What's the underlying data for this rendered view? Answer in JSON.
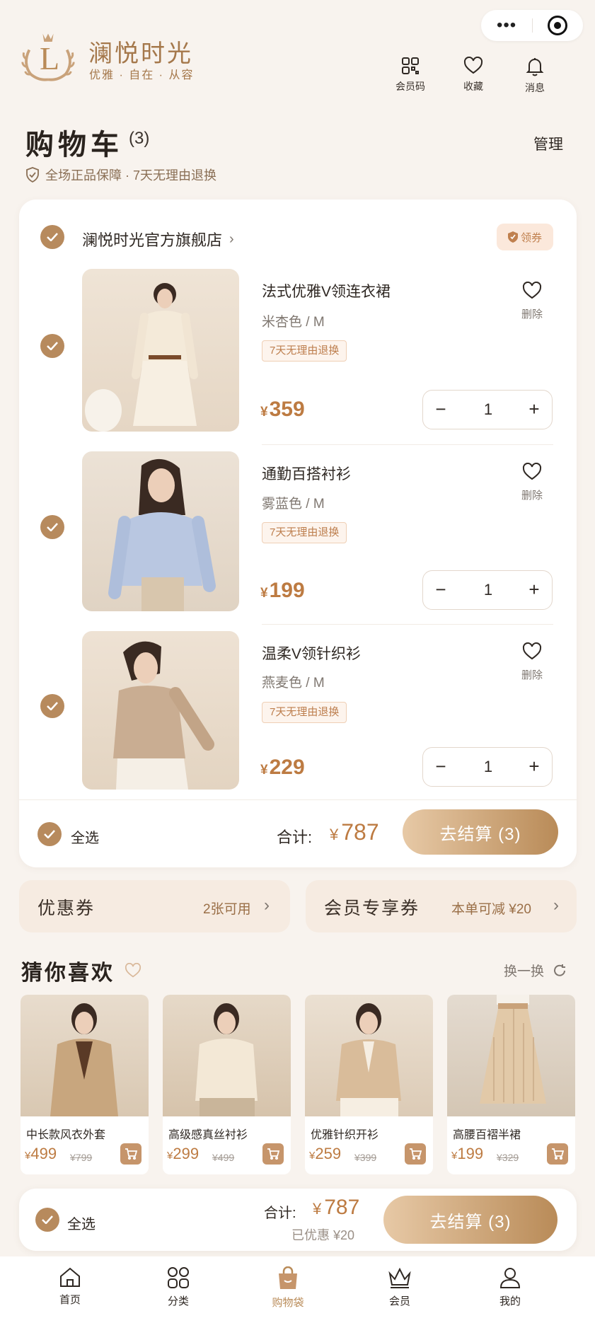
{
  "brand": {
    "name": "澜悦时光",
    "slogan": "优雅 · 自在 · 从容",
    "logo_letter": "L"
  },
  "header_icons": [
    {
      "icon": "qr-code-icon",
      "label": "会员码"
    },
    {
      "icon": "heart-icon",
      "label": "收藏"
    },
    {
      "icon": "bell-icon",
      "label": "消息"
    }
  ],
  "page": {
    "title": "购物车",
    "count": "(3)",
    "manage": "管理",
    "guarantee": "全场正品保障 · 7天无理由退换"
  },
  "store": {
    "name": "澜悦时光官方旗舰店",
    "coupon_badge": "领券"
  },
  "items": [
    {
      "name": "法式优雅V领连衣裙",
      "spec": "米杏色 / M",
      "tag": "7天无理由退换",
      "currency": "¥",
      "price": "359",
      "qty": "1",
      "delete": "删除",
      "checked": true
    },
    {
      "name": "通勤百搭衬衫",
      "spec": "雾蓝色 / M",
      "tag": "7天无理由退换",
      "currency": "¥",
      "price": "199",
      "qty": "1",
      "delete": "删除",
      "checked": true
    },
    {
      "name": "温柔V领针织衫",
      "spec": "燕麦色 / M",
      "tag": "7天无理由退换",
      "currency": "¥",
      "price": "229",
      "qty": "1",
      "delete": "删除",
      "checked": true
    }
  ],
  "summary": {
    "select_all": "全选",
    "total_label": "合计:",
    "currency": "¥",
    "total": "787",
    "checkout": "去结算 (3)"
  },
  "coupons": {
    "left_label": "优惠券",
    "left_value": "2张可用",
    "right_label": "会员专享券",
    "right_value": "本单可减 ¥20"
  },
  "recommend": {
    "title": "猜你喜欢",
    "refresh": "换一换",
    "items": [
      {
        "name": "中长款风衣外套",
        "currency": "¥",
        "price": "499",
        "orig": "¥799"
      },
      {
        "name": "高级感真丝衬衫",
        "currency": "¥",
        "price": "299",
        "orig": "¥499"
      },
      {
        "name": "优雅针织开衫",
        "currency": "¥",
        "price": "259",
        "orig": "¥399"
      },
      {
        "name": "高腰百褶半裙",
        "currency": "¥",
        "price": "199",
        "orig": "¥329"
      }
    ]
  },
  "bottom_bar": {
    "select_all": "全选",
    "total_label": "合计:",
    "currency": "¥",
    "total": "787",
    "discount": "已优惠 ¥20",
    "checkout": "去结算 (3)"
  },
  "tabs": [
    {
      "icon": "home-icon",
      "label": "首页"
    },
    {
      "icon": "category-icon",
      "label": "分类"
    },
    {
      "icon": "shopping-bag-icon",
      "label": "购物袋",
      "active": true
    },
    {
      "icon": "crown-icon",
      "label": "会员"
    },
    {
      "icon": "user-icon",
      "label": "我的"
    }
  ],
  "colors": {
    "accent": "#b78a5d",
    "price": "#bd7b42",
    "background": "#f8f3ee"
  }
}
